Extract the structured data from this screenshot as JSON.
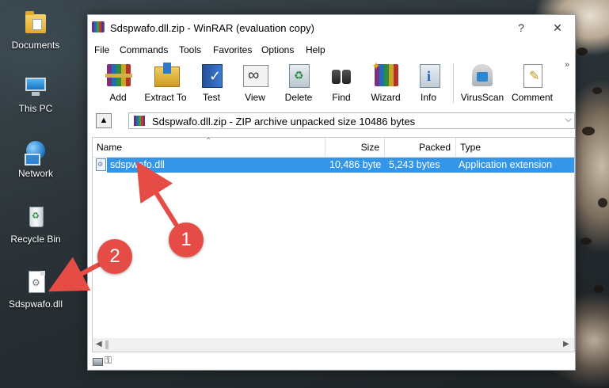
{
  "desktop": {
    "icons": [
      {
        "label": "Documents",
        "icon": "folder-icon"
      },
      {
        "label": "This PC",
        "icon": "computer-icon"
      },
      {
        "label": "Network",
        "icon": "network-icon"
      },
      {
        "label": "Recycle Bin",
        "icon": "recycle-bin-icon"
      },
      {
        "label": "Sdspwafo.dll",
        "icon": "dll-file-icon"
      }
    ]
  },
  "window": {
    "title": "Sdspwafo.dll.zip - WinRAR (evaluation copy)",
    "help_glyph": "?",
    "close_glyph": "✕"
  },
  "menu": [
    "File",
    "Commands",
    "Tools",
    "Favorites",
    "Options",
    "Help"
  ],
  "toolbar": {
    "buttons": [
      {
        "label": "Add",
        "icon": "add-archive-icon"
      },
      {
        "label": "Extract To",
        "icon": "extract-folder-icon"
      },
      {
        "label": "Test",
        "icon": "test-check-icon"
      },
      {
        "label": "View",
        "icon": "view-glasses-icon"
      },
      {
        "label": "Delete",
        "icon": "delete-recycle-icon"
      },
      {
        "label": "Find",
        "icon": "find-binoculars-icon"
      },
      {
        "label": "Wizard",
        "icon": "wizard-icon"
      },
      {
        "label": "Info",
        "icon": "info-icon"
      },
      {
        "label": "VirusScan",
        "icon": "virus-scan-icon"
      },
      {
        "label": "Comment",
        "icon": "comment-icon"
      }
    ],
    "overflow_glyph": "»"
  },
  "address": {
    "path": "Sdspwafo.dll.zip - ZIP archive unpacked size 10486 bytes"
  },
  "file_list": {
    "columns": [
      "Name",
      "Size",
      "Packed",
      "Type"
    ],
    "rows": [
      {
        "name": "sdspwafo.dll",
        "size": "10,486 byte",
        "packed": "5,243 bytes",
        "type": "Application extension"
      }
    ]
  },
  "annotations": [
    {
      "number": "1"
    },
    {
      "number": "2"
    }
  ],
  "colors": {
    "selection": "#3396e8",
    "callout": "#e44c45"
  }
}
